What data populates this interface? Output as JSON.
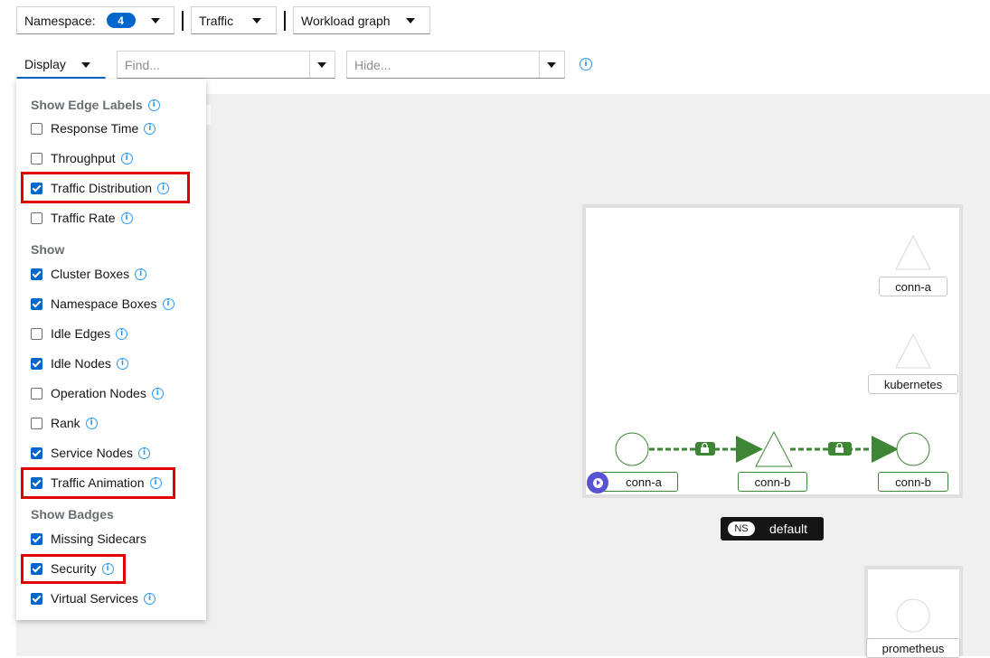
{
  "toolbar": {
    "namespace_label": "Namespace:",
    "namespace_count": "4",
    "traffic_label": "Traffic",
    "graph_type_label": "Workload graph",
    "display_label": "Display",
    "find_placeholder": "Find...",
    "hide_placeholder": "Hide..."
  },
  "display_menu": {
    "edge_labels_heading": "Show Edge Labels",
    "edge_labels": [
      {
        "label": "Response Time",
        "checked": false
      },
      {
        "label": "Throughput",
        "checked": false
      },
      {
        "label": "Traffic Distribution",
        "checked": true
      },
      {
        "label": "Traffic Rate",
        "checked": false
      }
    ],
    "show_heading": "Show",
    "show": [
      {
        "label": "Cluster Boxes",
        "checked": true
      },
      {
        "label": "Namespace Boxes",
        "checked": true
      },
      {
        "label": "Idle Edges",
        "checked": false
      },
      {
        "label": "Idle Nodes",
        "checked": true
      },
      {
        "label": "Operation Nodes",
        "checked": false
      },
      {
        "label": "Rank",
        "checked": false
      },
      {
        "label": "Service Nodes",
        "checked": true
      },
      {
        "label": "Traffic Animation",
        "checked": true
      }
    ],
    "badges_heading": "Show Badges",
    "badges": [
      {
        "label": "Missing Sidecars",
        "checked": true
      },
      {
        "label": "Security",
        "checked": true
      },
      {
        "label": "Virtual Services",
        "checked": true
      }
    ]
  },
  "graph": {
    "nodes": {
      "conn_a_top": "conn-a",
      "kubernetes": "kubernetes",
      "conn_a_bottom": "conn-a",
      "conn_b_mid": "conn-b",
      "conn_b_right": "conn-b",
      "prometheus": "prometheus"
    },
    "namespace_tag": "NS",
    "namespace_name": "default"
  },
  "colors": {
    "accent": "#0066cc",
    "edge_green": "#3e8635",
    "highlight_red": "#e00000",
    "info_blue": "#2b9af3"
  }
}
